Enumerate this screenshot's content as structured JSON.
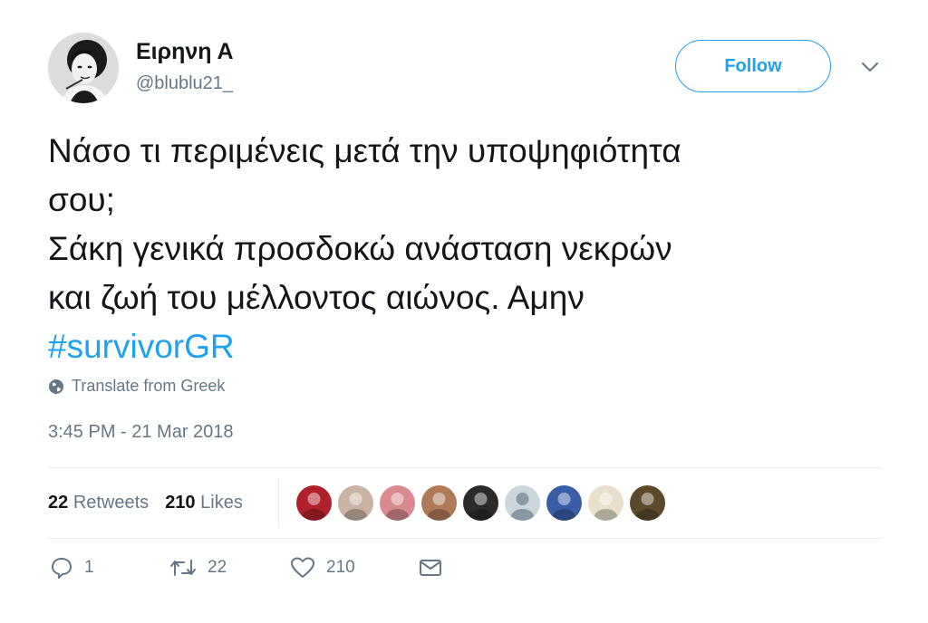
{
  "author": {
    "display_name": "Ειρηνη Α",
    "handle": "@blublu21_",
    "avatar_icon": "profile-photo-avatar"
  },
  "follow_button": {
    "label": "Follow"
  },
  "menu": {
    "icon": "chevron-down-icon"
  },
  "tweet": {
    "lines": [
      "Νάσο τι περιμένεις μετά την υποψηφιότητα",
      "σου;",
      "Σάκη γενικά προσδοκώ ανάσταση νεκρών",
      "και ζωή του μέλλοντος αιώνος. Αμην"
    ],
    "hashtag": "#survivorGR",
    "hashtag_color": "#1da1f2"
  },
  "translate": {
    "label": "Translate from Greek",
    "icon": "globe-icon"
  },
  "timestamp": "3:45 PM - 21 Mar 2018",
  "stats": {
    "retweets_count": "22",
    "retweets_label": "Retweets",
    "likes_count": "210",
    "likes_label": "Likes"
  },
  "likers": [
    {
      "name": "liker-avatar-1",
      "color": "#b0202a"
    },
    {
      "name": "liker-avatar-2",
      "color": "#c9b3a3"
    },
    {
      "name": "liker-avatar-3",
      "color": "#d98a8f"
    },
    {
      "name": "liker-avatar-4",
      "color": "#b07a58"
    },
    {
      "name": "liker-avatar-5",
      "color": "#2d2a2a"
    },
    {
      "name": "liker-avatar-6",
      "color": "#ccd6dd"
    },
    {
      "name": "liker-avatar-7",
      "color": "#3a5da8"
    },
    {
      "name": "liker-avatar-8",
      "color": "#e8e0cc"
    },
    {
      "name": "liker-avatar-9",
      "color": "#5a4a2a"
    }
  ],
  "actions": {
    "reply_count": "1",
    "retweet_count": "22",
    "like_count": "210"
  },
  "colors": {
    "accent": "#1da1f2",
    "muted_text": "#657786",
    "primary_text": "#14171a",
    "divider": "#e6ecf0"
  }
}
